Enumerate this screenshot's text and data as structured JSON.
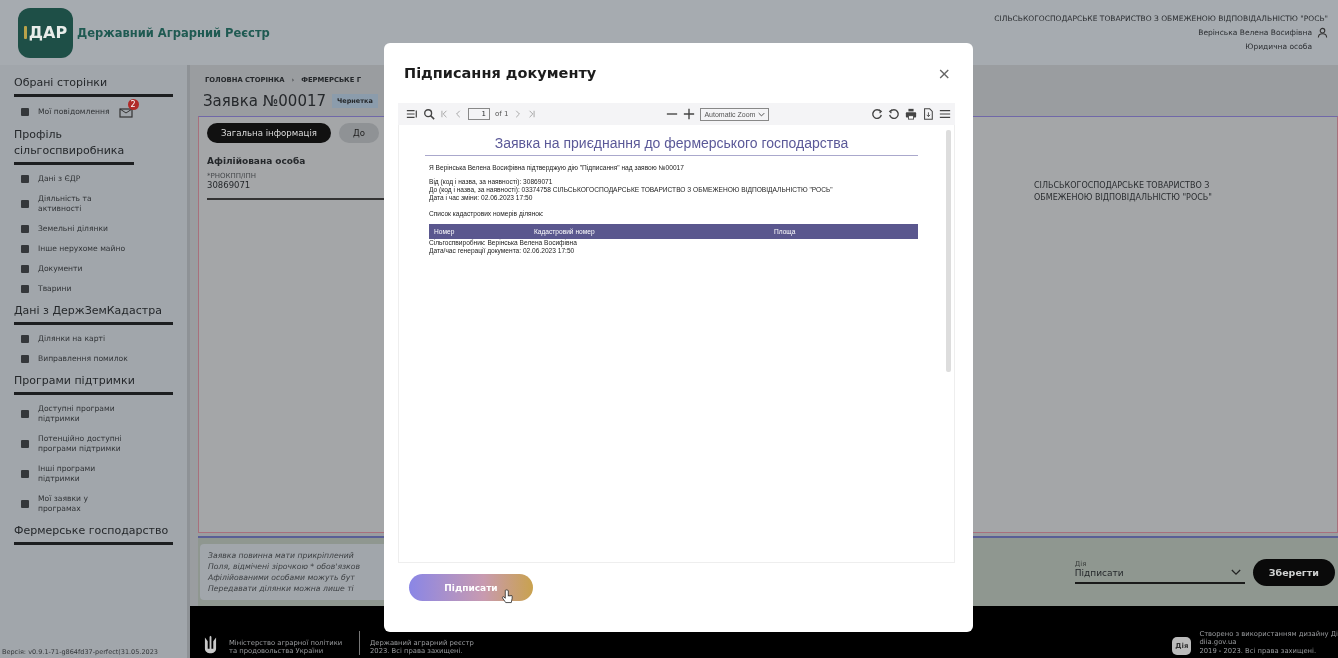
{
  "header": {
    "logo_mark": "ДАР",
    "logo_text": "Державний Аграрний Реєстр",
    "organization": "СІЛЬСЬКОГОСПОДАРСЬКЕ ТОВАРИСТВО З ОБМЕЖЕНОЮ ВІДПОВІДАЛЬНІСТЮ \"РОСЬ\"",
    "user_name": "Верінська Велена Восифівна",
    "user_role": "Юридична особа"
  },
  "sidebar": {
    "sections": [
      {
        "title": "Обрані сторінки",
        "items": [
          {
            "label": "Мої повідомлення",
            "badge": "2"
          }
        ]
      },
      {
        "title": "Профіль сільгоспвиробника",
        "items": [
          {
            "label": "Дані з ЄДР"
          },
          {
            "label": "Діяльність та активності"
          },
          {
            "label": "Земельні ділянки"
          },
          {
            "label": "Інше нерухоме майно"
          },
          {
            "label": "Документи"
          },
          {
            "label": "Тварини"
          }
        ]
      },
      {
        "title": "Дані з ДержЗемКадастра",
        "items": [
          {
            "label": "Ділянки на карті"
          },
          {
            "label": "Виправлення помилок"
          }
        ]
      },
      {
        "title": "Програми підтримки",
        "items": [
          {
            "label": "Доступні програми підтримки"
          },
          {
            "label": "Потенційно доступні програми підтримки"
          },
          {
            "label": "Інші програми підтримки"
          },
          {
            "label": "Мої заявки у програмах"
          }
        ]
      },
      {
        "title": "Фермерське господарство"
      }
    ],
    "version": "Версія: v0.9.1-71-g864fd37-perfect(31.05.2023"
  },
  "main": {
    "breadcrumbs": [
      "ГОЛОВНА СТОРІНКА",
      "ФЕРМЕРСЬКЕ Г"
    ],
    "breadcrumb_separator": "›",
    "title": "Заявка №00017",
    "status": "Чернетка",
    "tabs": [
      {
        "label": "Загальна інформація",
        "selected": true
      },
      {
        "label": "До",
        "selected": false
      }
    ],
    "section_title": "Афілійована особа",
    "field": {
      "label": "*РНОКПП/ІПН",
      "value": "30869071"
    },
    "organization": "СІЛЬСЬКОГОСПОДАРСЬКЕ ТОВАРИСТВО З ОБМЕЖЕНОЮ ВІДПОВІДАЛЬНІСТЮ \"РОСЬ\"",
    "notes": [
      "Заявка повинна мати прикріплений",
      "Поля, відмічені зірочкою * обов'язков",
      "Афілійованими особами можуть бут",
      "Передавати ділянки можна лише ті"
    ],
    "action": {
      "label": "Дія",
      "value": "Підписати"
    },
    "save_button": "Зберегти"
  },
  "footer": {
    "ministry": "Міністерство аграрної політики та продовольства України",
    "registry": "Державний аграрний реєстр 2023. Всі права захищені.",
    "diia_logo": "Дія",
    "credits": [
      "Створено з використанням дизайну Ді",
      "diia.gov.ua",
      "2019 - 2023. Всі права захищені."
    ]
  },
  "modal": {
    "title": "Підписання документу",
    "close": "×",
    "viewer": {
      "page": "1",
      "page_count": "of 1",
      "zoom": "Automatic Zoom"
    },
    "document": {
      "title": "Заявка на приєднання до фермерського господарства",
      "confirmation": "Я Верінська Велена Восифівна підтверджую дію \"Підписання\" над заявою №00017",
      "details": [
        "Від (код і назва, за наявності): 30869071",
        "До (код і назва, за наявності): 03374758 СІЛЬСЬКОГОСПОДАРСЬКЕ ТОВАРИСТВО З ОБМЕЖЕНОЮ ВІДПОВІДАЛЬНІСТЮ \"РОСЬ\"",
        "Дата і час зміни: 02.06.2023 17:50"
      ],
      "list_title": "Список кадастрових номерів ділянок:",
      "table_columns": [
        "Номер",
        "Кадастровий номер",
        "Площа"
      ],
      "footer_lines": [
        "Сільгоспвиробник: Верінська Велена Восифівна",
        "Дата/час генерації документа: 02.06.2023 17:50"
      ]
    },
    "sign_button": "Підписати"
  }
}
